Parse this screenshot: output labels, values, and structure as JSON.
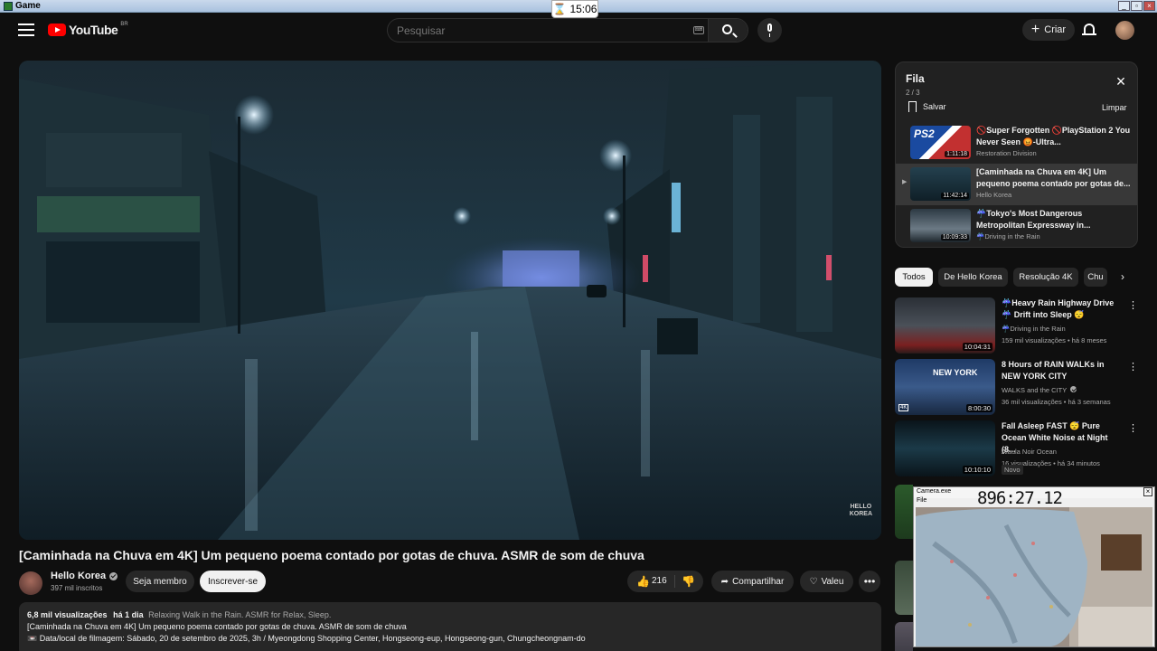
{
  "window": {
    "title": "Game"
  },
  "clock": {
    "time": "15:06"
  },
  "header": {
    "logo_text": "YouTube",
    "logo_country": "BR",
    "search_placeholder": "Pesquisar",
    "create_label": "Criar"
  },
  "video": {
    "title": "[Caminhada na Chuva em 4K] Um pequeno poema contado por gotas de chuva. ASMR de som de chuva",
    "watermark_line1": "HELLO",
    "watermark_line2": "KOREA",
    "channel_name": "Hello Korea",
    "subscribers": "397 mil inscritos",
    "member_label": "Seja membro",
    "subscribe_label": "Inscrever-se",
    "likes": "216",
    "share_label": "Compartilhar",
    "thanks_label": "Valeu",
    "views": "6,8 mil visualizações",
    "age": "há 1 dia",
    "tags": "Relaxing Walk in the Rain. ASMR for Relax, Sleep.",
    "description_line1": "[Caminhada na Chuva em 4K] Um pequeno poema contado por gotas de chuva. ASMR de som de chuva",
    "description_line2": "📼 Data/local de filmagem: Sábado, 20 de setembro de 2025, 3h / Myeongdong Shopping Center, Hongseong-eup, Hongseong-gun, Chungcheongnam-do"
  },
  "queue": {
    "title": "Fila",
    "count": "2 / 3",
    "save_label": "Salvar",
    "clear_label": "Limpar",
    "items": [
      {
        "title": "🚫Super Forgotten 🚫PlayStation 2 You Never Seen 😡-Ultra...",
        "channel": "Restoration Division",
        "duration": "1:11:18",
        "thumb_label": "PS2"
      },
      {
        "title": "[Caminhada na Chuva em 4K] Um pequeno poema contado por gotas de...",
        "channel": "Hello Korea",
        "duration": "11:42:14"
      },
      {
        "title": "☔Tokyo's Most Dangerous Metropolitan Expressway in...",
        "channel": "☔Driving in the Rain",
        "duration": "10:09:33"
      }
    ]
  },
  "chips": [
    "Todos",
    "De Hello Korea",
    "Resolução 4K",
    "Chu"
  ],
  "recommendations": [
    {
      "title": "☔Heavy Rain Highway Drive☔ Drift into Sleep 😴",
      "channel": "☔Driving in the Rain",
      "stats": "159 mil visualizações • há 8 meses",
      "duration": "10:04:31"
    },
    {
      "title": "8 Hours of RAIN WALKs in NEW YORK CITY",
      "channel": "WALKS and the CITY",
      "stats": "36 mil visualizações • há 3 semanas",
      "duration": "8:00:30",
      "thumb_label": "NEW YORK",
      "quality_badge": "4K"
    },
    {
      "title": "Fall Asleep FAST 😴 Pure Ocean White Noise at Night (8...",
      "channel": "Alaula Noir Ocean",
      "stats": "16 visualizações • há 34 minutos",
      "duration": "10:10:10",
      "badge": "Novo"
    }
  ],
  "camera": {
    "title": "Camera.exe",
    "menu": "File",
    "timer": "896:27.12"
  }
}
